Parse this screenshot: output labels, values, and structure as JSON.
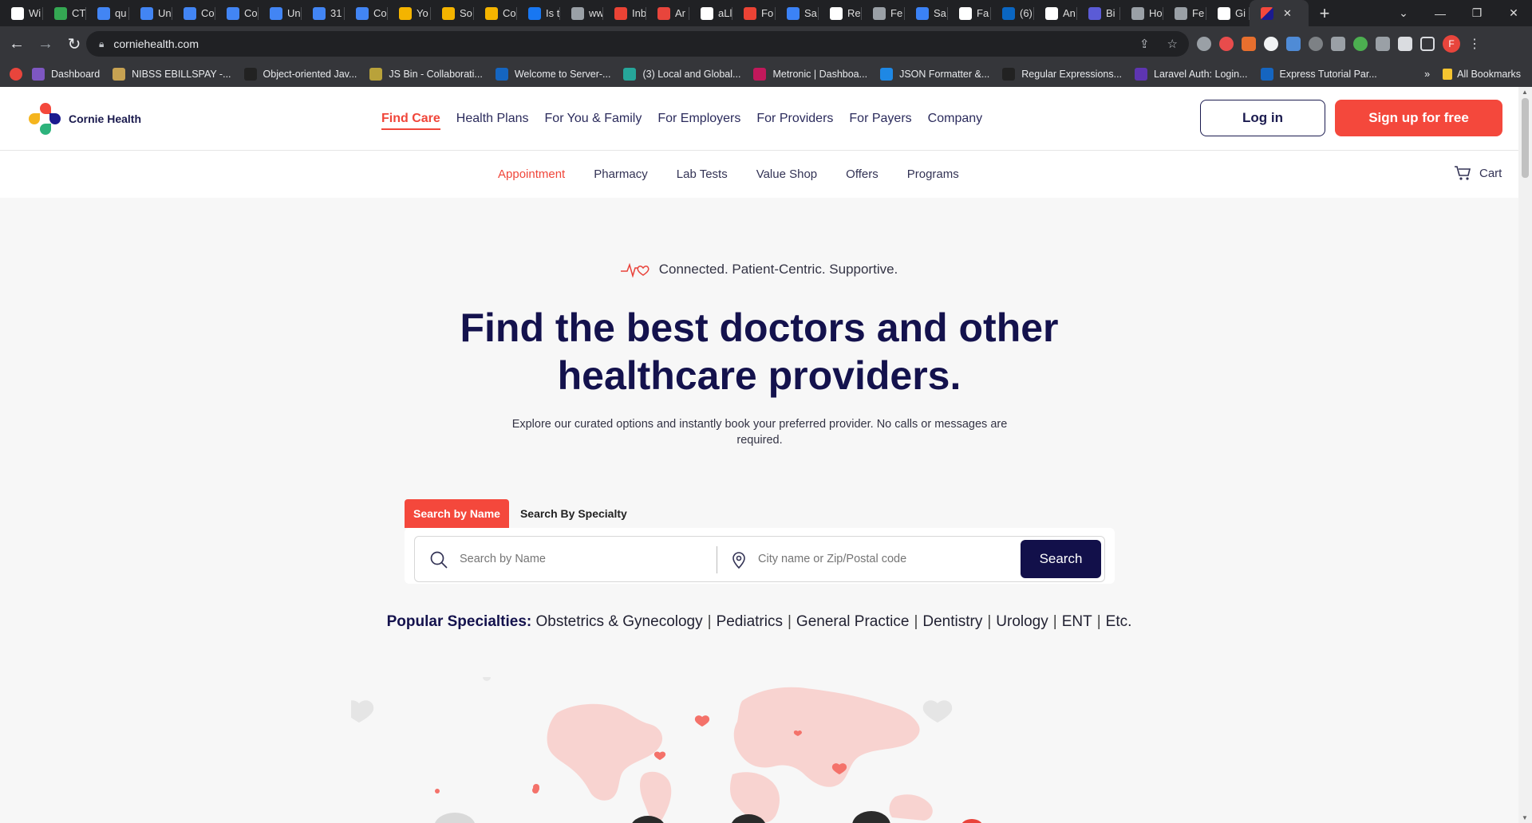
{
  "browser": {
    "tabs": [
      {
        "title": "Wi",
        "icon": "github-icon",
        "color": "#ffffff"
      },
      {
        "title": "CT",
        "icon": "google-drive-icon",
        "color": "#34a853"
      },
      {
        "title": "qu",
        "icon": "docs-icon",
        "color": "#4285f4"
      },
      {
        "title": "Un",
        "icon": "docs-icon",
        "color": "#4285f4"
      },
      {
        "title": "Co",
        "icon": "docs-icon",
        "color": "#4285f4"
      },
      {
        "title": "Co",
        "icon": "docs-icon",
        "color": "#4285f4"
      },
      {
        "title": "Un",
        "icon": "docs-icon",
        "color": "#4285f4"
      },
      {
        "title": "31",
        "icon": "docs-icon",
        "color": "#4285f4"
      },
      {
        "title": "Co",
        "icon": "docs-icon",
        "color": "#4285f4"
      },
      {
        "title": "Yo",
        "icon": "slides-icon",
        "color": "#f4b400"
      },
      {
        "title": "So",
        "icon": "slides-icon",
        "color": "#f4b400"
      },
      {
        "title": "Co",
        "icon": "slides-icon",
        "color": "#f4b400"
      },
      {
        "title": "Is t",
        "icon": "facebook-icon",
        "color": "#1877f2"
      },
      {
        "title": "ww",
        "icon": "globe-icon",
        "color": "#9aa0a6"
      },
      {
        "title": "Inb",
        "icon": "gmail-icon",
        "color": "#ea4335"
      },
      {
        "title": "Ar",
        "icon": "generic-site-icon",
        "color": "#e8453c"
      },
      {
        "title": "aLl",
        "icon": "rx-icon",
        "color": "#ffffff"
      },
      {
        "title": "Fo",
        "icon": "stop-icon",
        "color": "#ea4335"
      },
      {
        "title": "Sa",
        "icon": "check-badge-icon",
        "color": "#3b82f6"
      },
      {
        "title": "Re",
        "icon": "rx-icon",
        "color": "#ffffff"
      },
      {
        "title": "Fe",
        "icon": "globe-icon",
        "color": "#9aa0a6"
      },
      {
        "title": "Sa",
        "icon": "check-badge-icon",
        "color": "#3b82f6"
      },
      {
        "title": "Fa",
        "icon": "wikipedia-icon",
        "color": "#ffffff"
      },
      {
        "title": "(6)",
        "icon": "linkedin-icon",
        "color": "#0a66c2"
      },
      {
        "title": "An",
        "icon": "pen-icon",
        "color": "#ffffff"
      },
      {
        "title": "Bi",
        "icon": "generic-site-icon",
        "color": "#5b5bd6"
      },
      {
        "title": "Ho",
        "icon": "globe-icon",
        "color": "#9aa0a6"
      },
      {
        "title": "Fe",
        "icon": "globe-icon",
        "color": "#9aa0a6"
      },
      {
        "title": "Gi",
        "icon": "github-icon",
        "color": "#ffffff"
      }
    ],
    "url": "corniehealth.com",
    "bookmarks": [
      {
        "label": "Dashboard",
        "color": "#7e57c2"
      },
      {
        "label": "NIBSS EBILLSPAY -...",
        "color": "#c7a252"
      },
      {
        "label": "Object-oriented Jav...",
        "color": "#222222"
      },
      {
        "label": "JS Bin - Collaborati...",
        "color": "#b9a23a"
      },
      {
        "label": "Welcome to Server-...",
        "color": "#1565c0"
      },
      {
        "label": "(3) Local and Global...",
        "color": "#26a69a"
      },
      {
        "label": "Metronic | Dashboa...",
        "color": "#c2185b"
      },
      {
        "label": "JSON Formatter &...",
        "color": "#1e88e5"
      },
      {
        "label": "Regular Expressions...",
        "color": "#222222"
      },
      {
        "label": "Laravel Auth: Login...",
        "color": "#5e35b1"
      },
      {
        "label": "Express Tutorial Par...",
        "color": "#1565c0"
      }
    ],
    "all_bookmarks": "All Bookmarks",
    "profile_initial": "F"
  },
  "site": {
    "logo_text": "Cornie Health",
    "nav": [
      "Find Care",
      "Health Plans",
      "For You & Family",
      "For Employers",
      "For Providers",
      "For Payers",
      "Company"
    ],
    "login": "Log in",
    "signup": "Sign up for free",
    "subnav": [
      "Appointment",
      "Pharmacy",
      "Lab Tests",
      "Value Shop",
      "Offers",
      "Programs"
    ],
    "cart": "Cart",
    "tagline": "Connected. Patient-Centric. Supportive.",
    "headline_line1": "Find the best doctors and other",
    "headline_line2": "healthcare providers.",
    "subtext": "Explore our curated options and instantly book your preferred provider. No calls or messages are required.",
    "search_tabs": {
      "by_name": "Search by Name",
      "by_specialty": "Search By Specialty"
    },
    "search": {
      "name_placeholder": "Search by Name",
      "location_placeholder": "City name or Zip/Postal code",
      "button": "Search"
    },
    "popular_label": "Popular Specialties:",
    "specialties": [
      "Obstetrics & Gynecology",
      "Pediatrics",
      "General Practice",
      "Dentistry",
      "Urology",
      "ENT",
      "Etc."
    ]
  },
  "colors": {
    "brand_red": "#f4483c",
    "brand_navy": "#14124d"
  }
}
